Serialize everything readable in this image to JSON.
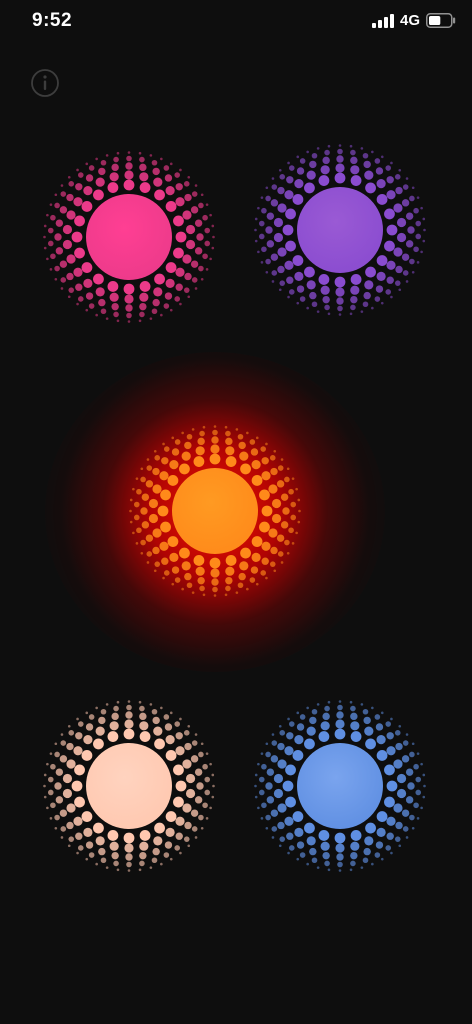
{
  "status_bar": {
    "time": "9:52",
    "network": "4G",
    "signal_icon": "cellular-signal-icon",
    "battery_icon": "battery-icon",
    "battery_level": 0.55
  },
  "info_icon": "info-icon",
  "orbs": [
    {
      "name": "pink-orb",
      "color": "#ff3f93",
      "dot_color": "#ec3a8a",
      "selected": false
    },
    {
      "name": "purple-orb",
      "color": "#9a5ad4",
      "dot_color": "#8a4cd0",
      "selected": false
    },
    {
      "name": "orange-orb",
      "color": "#ff9a22",
      "dot_color": "#ff8a1a",
      "selected": true,
      "glow_color": "#ff1400"
    },
    {
      "name": "peach-orb",
      "color": "#ffd3bf",
      "dot_color": "#ffc8b0",
      "selected": false
    },
    {
      "name": "blue-orb",
      "color": "#7aa4ee",
      "dot_color": "#5f8fe2",
      "selected": false
    }
  ]
}
